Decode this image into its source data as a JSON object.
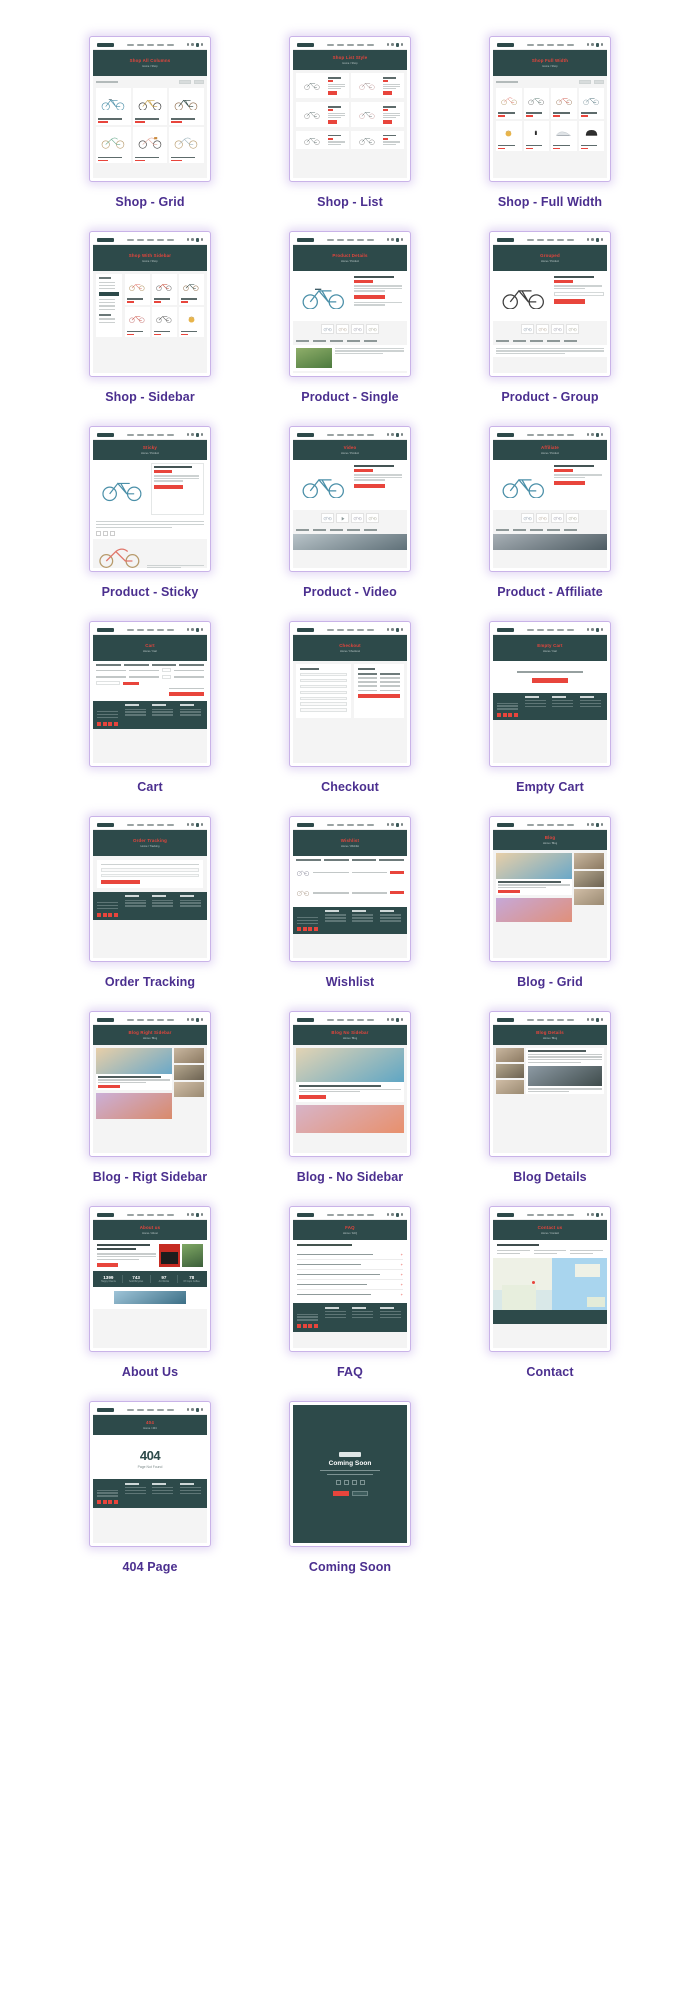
{
  "page": {
    "background": "#ffffff",
    "caption_color": "#4b2f8f",
    "accent_color": "#e8453c",
    "dark_color": "#2d4a4a",
    "frame_border_color": "#c9b3e8"
  },
  "items": [
    {
      "id": "shop-grid",
      "label": "Shop - Grid",
      "banner_title": "Shop All Columns",
      "banner_sub": "Home / Shop"
    },
    {
      "id": "shop-list",
      "label": "Shop - List",
      "banner_title": "Shop List Style",
      "banner_sub": "Home / Shop"
    },
    {
      "id": "shop-full-width",
      "label": "Shop - Full Width",
      "banner_title": "Shop Full Width",
      "banner_sub": "Home / Shop"
    },
    {
      "id": "shop-sidebar",
      "label": "Shop - Sidebar",
      "banner_title": "Shop With Sidebar",
      "banner_sub": "Home / Shop"
    },
    {
      "id": "product-single",
      "label": "Product - Single",
      "banner_title": "Product Details",
      "banner_sub": "Home / Product"
    },
    {
      "id": "product-group",
      "label": "Product - Group",
      "banner_title": "Grouped",
      "banner_sub": "Home / Product"
    },
    {
      "id": "product-sticky",
      "label": "Product - Sticky",
      "banner_title": "Sticky",
      "banner_sub": "Home / Product"
    },
    {
      "id": "product-video",
      "label": "Product - Video",
      "banner_title": "Video",
      "banner_sub": "Home / Product"
    },
    {
      "id": "product-affiliate",
      "label": "Product - Affiliate",
      "banner_title": "Affiliate",
      "banner_sub": "Home / Product"
    },
    {
      "id": "cart",
      "label": "Cart",
      "banner_title": "Cart",
      "banner_sub": "Home / Cart"
    },
    {
      "id": "checkout",
      "label": "Checkout",
      "banner_title": "Checkout",
      "banner_sub": "Home / Checkout"
    },
    {
      "id": "empty-cart",
      "label": "Empty Cart",
      "banner_title": "Empty Cart",
      "banner_sub": "Home / Cart"
    },
    {
      "id": "order-tracking",
      "label": "Order Tracking",
      "banner_title": "Order Tracking",
      "banner_sub": "Home / Tracking"
    },
    {
      "id": "wishlist",
      "label": "Wishlist",
      "banner_title": "Wishlist",
      "banner_sub": "Home / Wishlist"
    },
    {
      "id": "blog-grid",
      "label": "Blog - Grid",
      "banner_title": "Blog",
      "banner_sub": "Home / Blog"
    },
    {
      "id": "blog-right-sidebar",
      "label": "Blog - Rigt Sidebar",
      "banner_title": "Blog Right Sidebar",
      "banner_sub": "Home / Blog"
    },
    {
      "id": "blog-no-sidebar",
      "label": "Blog - No Sidebar",
      "banner_title": "Blog No Sidebar",
      "banner_sub": "Home / Blog"
    },
    {
      "id": "blog-details",
      "label": "Blog Details",
      "banner_title": "Blog Details",
      "banner_sub": "Home / Blog"
    },
    {
      "id": "about-us",
      "label": "About Us",
      "banner_title": "About us",
      "banner_sub": "Home / About"
    },
    {
      "id": "faq",
      "label": "FAQ",
      "banner_title": "FAQ",
      "banner_sub": "Home / FAQ"
    },
    {
      "id": "contact",
      "label": "Contact",
      "banner_title": "Contact us",
      "banner_sub": "Home / Contact"
    },
    {
      "id": "404-page",
      "label": "404 Page",
      "banner_title": "404",
      "banner_sub": "Home / 404"
    },
    {
      "id": "coming-soon",
      "label": "Coming Soon",
      "banner_title": "Coming Soon",
      "banner_sub": ""
    }
  ],
  "error_page": {
    "code": "404",
    "message": "Page Not Found"
  },
  "coming_soon": {
    "heading": "Coming Soon",
    "sub": "Website Is Under Construction",
    "note": "Our Site Is Opening Soon In Count Down Below"
  },
  "about_stats": {
    "values": [
      "1399",
      "743",
      "97",
      "78"
    ],
    "labels": [
      "Happy Clients",
      "Sold Bicycles",
      "Art Works",
      "Of Cups Coffee"
    ]
  }
}
